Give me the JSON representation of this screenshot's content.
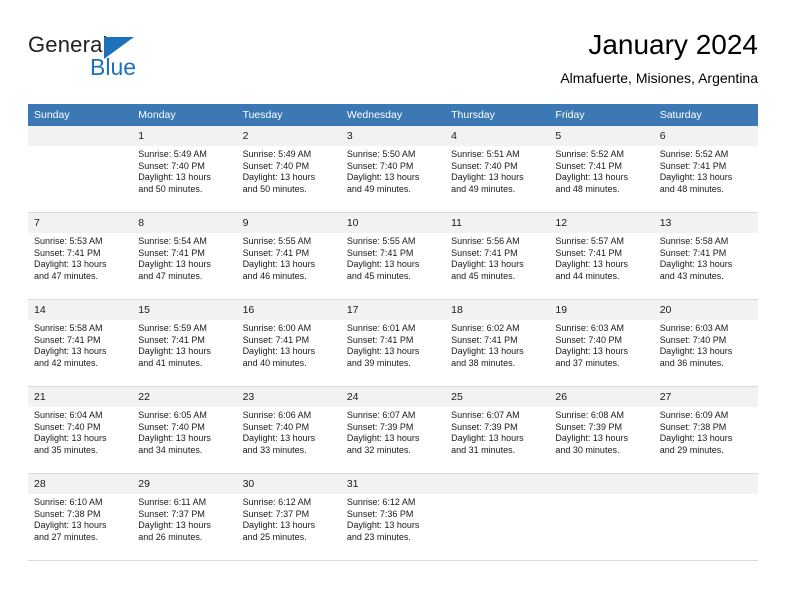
{
  "brand": {
    "name_part1": "General",
    "name_part2": "Blue",
    "accent_color": "#1c72b8"
  },
  "header": {
    "title": "January 2024",
    "subtitle": "Almafuerte, Misiones, Argentina"
  },
  "theme": {
    "header_bg": "#3b78b4",
    "daynum_bg": "#f2f2f2",
    "row_divider": "#3b78b4"
  },
  "weekday_headers": [
    "Sunday",
    "Monday",
    "Tuesday",
    "Wednesday",
    "Thursday",
    "Friday",
    "Saturday"
  ],
  "weeks": [
    [
      {
        "day": "",
        "sunrise": "",
        "sunset": "",
        "daylight1": "",
        "daylight2": "",
        "empty": true
      },
      {
        "day": "1",
        "sunrise": "Sunrise: 5:49 AM",
        "sunset": "Sunset: 7:40 PM",
        "daylight1": "Daylight: 13 hours",
        "daylight2": "and 50 minutes."
      },
      {
        "day": "2",
        "sunrise": "Sunrise: 5:49 AM",
        "sunset": "Sunset: 7:40 PM",
        "daylight1": "Daylight: 13 hours",
        "daylight2": "and 50 minutes."
      },
      {
        "day": "3",
        "sunrise": "Sunrise: 5:50 AM",
        "sunset": "Sunset: 7:40 PM",
        "daylight1": "Daylight: 13 hours",
        "daylight2": "and 49 minutes."
      },
      {
        "day": "4",
        "sunrise": "Sunrise: 5:51 AM",
        "sunset": "Sunset: 7:40 PM",
        "daylight1": "Daylight: 13 hours",
        "daylight2": "and 49 minutes."
      },
      {
        "day": "5",
        "sunrise": "Sunrise: 5:52 AM",
        "sunset": "Sunset: 7:41 PM",
        "daylight1": "Daylight: 13 hours",
        "daylight2": "and 48 minutes."
      },
      {
        "day": "6",
        "sunrise": "Sunrise: 5:52 AM",
        "sunset": "Sunset: 7:41 PM",
        "daylight1": "Daylight: 13 hours",
        "daylight2": "and 48 minutes."
      }
    ],
    [
      {
        "day": "7",
        "sunrise": "Sunrise: 5:53 AM",
        "sunset": "Sunset: 7:41 PM",
        "daylight1": "Daylight: 13 hours",
        "daylight2": "and 47 minutes."
      },
      {
        "day": "8",
        "sunrise": "Sunrise: 5:54 AM",
        "sunset": "Sunset: 7:41 PM",
        "daylight1": "Daylight: 13 hours",
        "daylight2": "and 47 minutes."
      },
      {
        "day": "9",
        "sunrise": "Sunrise: 5:55 AM",
        "sunset": "Sunset: 7:41 PM",
        "daylight1": "Daylight: 13 hours",
        "daylight2": "and 46 minutes."
      },
      {
        "day": "10",
        "sunrise": "Sunrise: 5:55 AM",
        "sunset": "Sunset: 7:41 PM",
        "daylight1": "Daylight: 13 hours",
        "daylight2": "and 45 minutes."
      },
      {
        "day": "11",
        "sunrise": "Sunrise: 5:56 AM",
        "sunset": "Sunset: 7:41 PM",
        "daylight1": "Daylight: 13 hours",
        "daylight2": "and 45 minutes."
      },
      {
        "day": "12",
        "sunrise": "Sunrise: 5:57 AM",
        "sunset": "Sunset: 7:41 PM",
        "daylight1": "Daylight: 13 hours",
        "daylight2": "and 44 minutes."
      },
      {
        "day": "13",
        "sunrise": "Sunrise: 5:58 AM",
        "sunset": "Sunset: 7:41 PM",
        "daylight1": "Daylight: 13 hours",
        "daylight2": "and 43 minutes."
      }
    ],
    [
      {
        "day": "14",
        "sunrise": "Sunrise: 5:58 AM",
        "sunset": "Sunset: 7:41 PM",
        "daylight1": "Daylight: 13 hours",
        "daylight2": "and 42 minutes."
      },
      {
        "day": "15",
        "sunrise": "Sunrise: 5:59 AM",
        "sunset": "Sunset: 7:41 PM",
        "daylight1": "Daylight: 13 hours",
        "daylight2": "and 41 minutes."
      },
      {
        "day": "16",
        "sunrise": "Sunrise: 6:00 AM",
        "sunset": "Sunset: 7:41 PM",
        "daylight1": "Daylight: 13 hours",
        "daylight2": "and 40 minutes."
      },
      {
        "day": "17",
        "sunrise": "Sunrise: 6:01 AM",
        "sunset": "Sunset: 7:41 PM",
        "daylight1": "Daylight: 13 hours",
        "daylight2": "and 39 minutes."
      },
      {
        "day": "18",
        "sunrise": "Sunrise: 6:02 AM",
        "sunset": "Sunset: 7:41 PM",
        "daylight1": "Daylight: 13 hours",
        "daylight2": "and 38 minutes."
      },
      {
        "day": "19",
        "sunrise": "Sunrise: 6:03 AM",
        "sunset": "Sunset: 7:40 PM",
        "daylight1": "Daylight: 13 hours",
        "daylight2": "and 37 minutes."
      },
      {
        "day": "20",
        "sunrise": "Sunrise: 6:03 AM",
        "sunset": "Sunset: 7:40 PM",
        "daylight1": "Daylight: 13 hours",
        "daylight2": "and 36 minutes."
      }
    ],
    [
      {
        "day": "21",
        "sunrise": "Sunrise: 6:04 AM",
        "sunset": "Sunset: 7:40 PM",
        "daylight1": "Daylight: 13 hours",
        "daylight2": "and 35 minutes."
      },
      {
        "day": "22",
        "sunrise": "Sunrise: 6:05 AM",
        "sunset": "Sunset: 7:40 PM",
        "daylight1": "Daylight: 13 hours",
        "daylight2": "and 34 minutes."
      },
      {
        "day": "23",
        "sunrise": "Sunrise: 6:06 AM",
        "sunset": "Sunset: 7:40 PM",
        "daylight1": "Daylight: 13 hours",
        "daylight2": "and 33 minutes."
      },
      {
        "day": "24",
        "sunrise": "Sunrise: 6:07 AM",
        "sunset": "Sunset: 7:39 PM",
        "daylight1": "Daylight: 13 hours",
        "daylight2": "and 32 minutes."
      },
      {
        "day": "25",
        "sunrise": "Sunrise: 6:07 AM",
        "sunset": "Sunset: 7:39 PM",
        "daylight1": "Daylight: 13 hours",
        "daylight2": "and 31 minutes."
      },
      {
        "day": "26",
        "sunrise": "Sunrise: 6:08 AM",
        "sunset": "Sunset: 7:39 PM",
        "daylight1": "Daylight: 13 hours",
        "daylight2": "and 30 minutes."
      },
      {
        "day": "27",
        "sunrise": "Sunrise: 6:09 AM",
        "sunset": "Sunset: 7:38 PM",
        "daylight1": "Daylight: 13 hours",
        "daylight2": "and 29 minutes."
      }
    ],
    [
      {
        "day": "28",
        "sunrise": "Sunrise: 6:10 AM",
        "sunset": "Sunset: 7:38 PM",
        "daylight1": "Daylight: 13 hours",
        "daylight2": "and 27 minutes."
      },
      {
        "day": "29",
        "sunrise": "Sunrise: 6:11 AM",
        "sunset": "Sunset: 7:37 PM",
        "daylight1": "Daylight: 13 hours",
        "daylight2": "and 26 minutes."
      },
      {
        "day": "30",
        "sunrise": "Sunrise: 6:12 AM",
        "sunset": "Sunset: 7:37 PM",
        "daylight1": "Daylight: 13 hours",
        "daylight2": "and 25 minutes."
      },
      {
        "day": "31",
        "sunrise": "Sunrise: 6:12 AM",
        "sunset": "Sunset: 7:36 PM",
        "daylight1": "Daylight: 13 hours",
        "daylight2": "and 23 minutes."
      },
      {
        "day": "",
        "sunrise": "",
        "sunset": "",
        "daylight1": "",
        "daylight2": "",
        "empty": true
      },
      {
        "day": "",
        "sunrise": "",
        "sunset": "",
        "daylight1": "",
        "daylight2": "",
        "empty": true
      },
      {
        "day": "",
        "sunrise": "",
        "sunset": "",
        "daylight1": "",
        "daylight2": "",
        "empty": true
      }
    ]
  ]
}
